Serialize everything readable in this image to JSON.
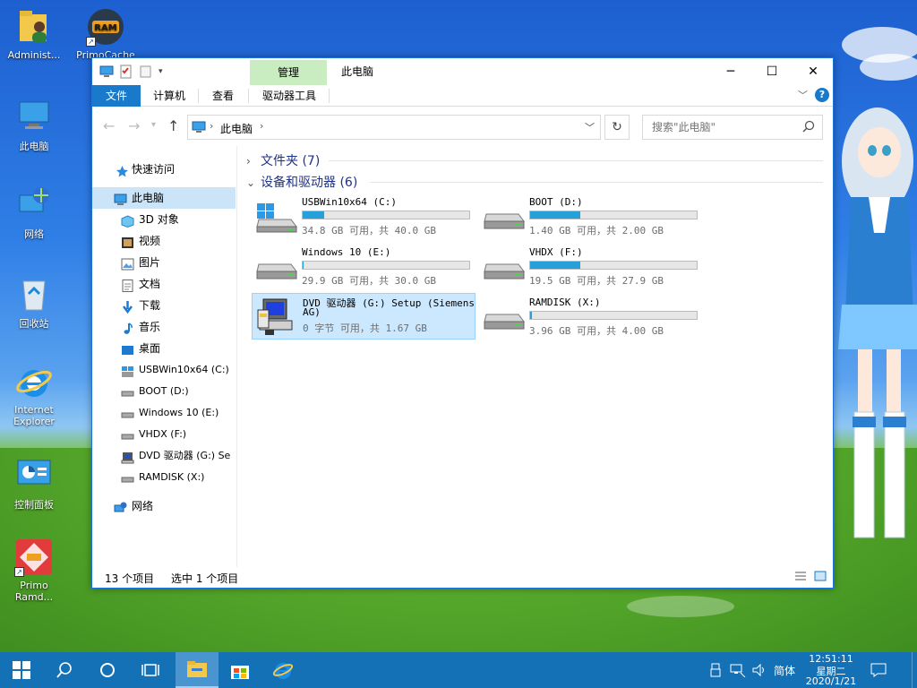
{
  "desktop": {
    "icons": [
      {
        "label": "Administ...",
        "icon": "user-folder-icon"
      },
      {
        "label": "PrimoCache",
        "icon": "ram-icon"
      },
      {
        "label": "此电脑",
        "icon": "computer-icon"
      },
      {
        "label": "网络",
        "icon": "network-icon"
      },
      {
        "label": "回收站",
        "icon": "recycle-bin-icon"
      },
      {
        "label": "Internet Explorer",
        "icon": "ie-icon"
      },
      {
        "label": "控制面板",
        "icon": "control-panel-icon"
      },
      {
        "label": "Primo Ramd...",
        "icon": "primo-ramdisk-icon"
      }
    ]
  },
  "window": {
    "manage_tab": "管理",
    "title": "此电脑",
    "ribbon_tabs": [
      "文件",
      "计算机",
      "查看",
      "驱动器工具"
    ],
    "address": {
      "crumb": "此电脑"
    },
    "search": {
      "placeholder": "搜索\"此电脑\""
    },
    "nav": {
      "quick_access": "快速访问",
      "this_pc": "此电脑",
      "items": [
        "3D 对象",
        "视频",
        "图片",
        "文档",
        "下载",
        "音乐",
        "桌面"
      ],
      "drives": [
        "USBWin10x64 (C:)",
        "BOOT (D:)",
        "Windows 10 (E:)",
        "VHDX (F:)",
        "DVD 驱动器 (G:) Se",
        "RAMDISK (X:)"
      ],
      "network": "网络"
    },
    "groups": {
      "folders": "文件夹 (7)",
      "devices": "设备和驱动器 (6)"
    },
    "drives": [
      {
        "name": "USBWin10x64 (C:)",
        "info": "34.8 GB 可用，共 40.0 GB",
        "used_fraction": 0.13,
        "icon": "windows-drive-icon"
      },
      {
        "name": "BOOT (D:)",
        "info": "1.40 GB 可用，共 2.00 GB",
        "used_fraction": 0.3,
        "icon": "hard-drive-icon"
      },
      {
        "name": "Windows 10 (E:)",
        "info": "29.9 GB 可用，共 30.0 GB",
        "used_fraction": 0.003,
        "icon": "hard-drive-icon"
      },
      {
        "name": "VHDX (F:)",
        "info": "19.5 GB 可用，共 27.9 GB",
        "used_fraction": 0.3,
        "icon": "hard-drive-icon"
      },
      {
        "name_line1": "DVD 驱动器 (G:) Setup (Siemens",
        "name_line2": "AG)",
        "info": "0 字节 可用，共 1.67 GB",
        "icon": "dvd-setup-icon"
      },
      {
        "name": "RAMDISK (X:)",
        "info": "3.96 GB 可用，共 4.00 GB",
        "used_fraction": 0.01,
        "icon": "hard-drive-icon"
      }
    ],
    "status": {
      "count": "13 个项目",
      "selected": "选中 1 个项目"
    }
  },
  "taskbar": {
    "ime": "简体",
    "time": "12:51:11",
    "weekday": "星期二",
    "date": "2020/1/21"
  },
  "colors": {
    "accent": "#1979ca",
    "manage_tab": "#c9ecc0",
    "drive_bar": "#26a0da",
    "taskbar": "#1471b6",
    "selection": "#cce8ff"
  }
}
